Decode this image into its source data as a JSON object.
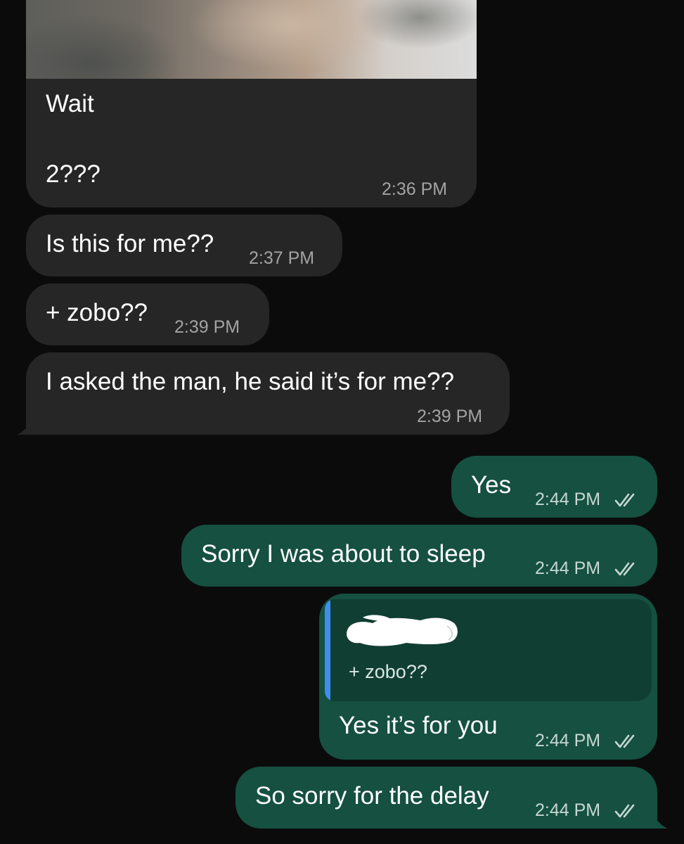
{
  "messages": {
    "m1": {
      "direction": "incoming",
      "line1": "Wait",
      "line2": "2???",
      "time": "2:36 PM"
    },
    "m2": {
      "direction": "incoming",
      "text": "Is this for me??",
      "time": "2:37 PM"
    },
    "m3": {
      "direction": "incoming",
      "text": "+ zobo??",
      "time": "2:39 PM"
    },
    "m4": {
      "direction": "incoming",
      "text": "I asked the man, he said it’s for me??",
      "time": "2:39 PM"
    },
    "m5": {
      "direction": "outgoing",
      "text": "Yes",
      "time": "2:44 PM",
      "status_icon": "double-check-icon"
    },
    "m6": {
      "direction": "outgoing",
      "text": "Sorry I was about to sleep",
      "time": "2:44 PM",
      "status_icon": "double-check-icon"
    },
    "m7": {
      "direction": "outgoing",
      "quoted_text": "+ zobo??",
      "text": "Yes it’s for you",
      "time": "2:44 PM",
      "status_icon": "double-check-icon"
    },
    "m8": {
      "direction": "outgoing",
      "text": "So sorry for the delay",
      "time": "2:44 PM",
      "status_icon": "double-check-icon"
    }
  },
  "colors": {
    "background": "#0b0b0b",
    "incoming_bubble": "#262626",
    "outgoing_bubble": "#155040",
    "quote_accent": "#3e8ef0"
  }
}
